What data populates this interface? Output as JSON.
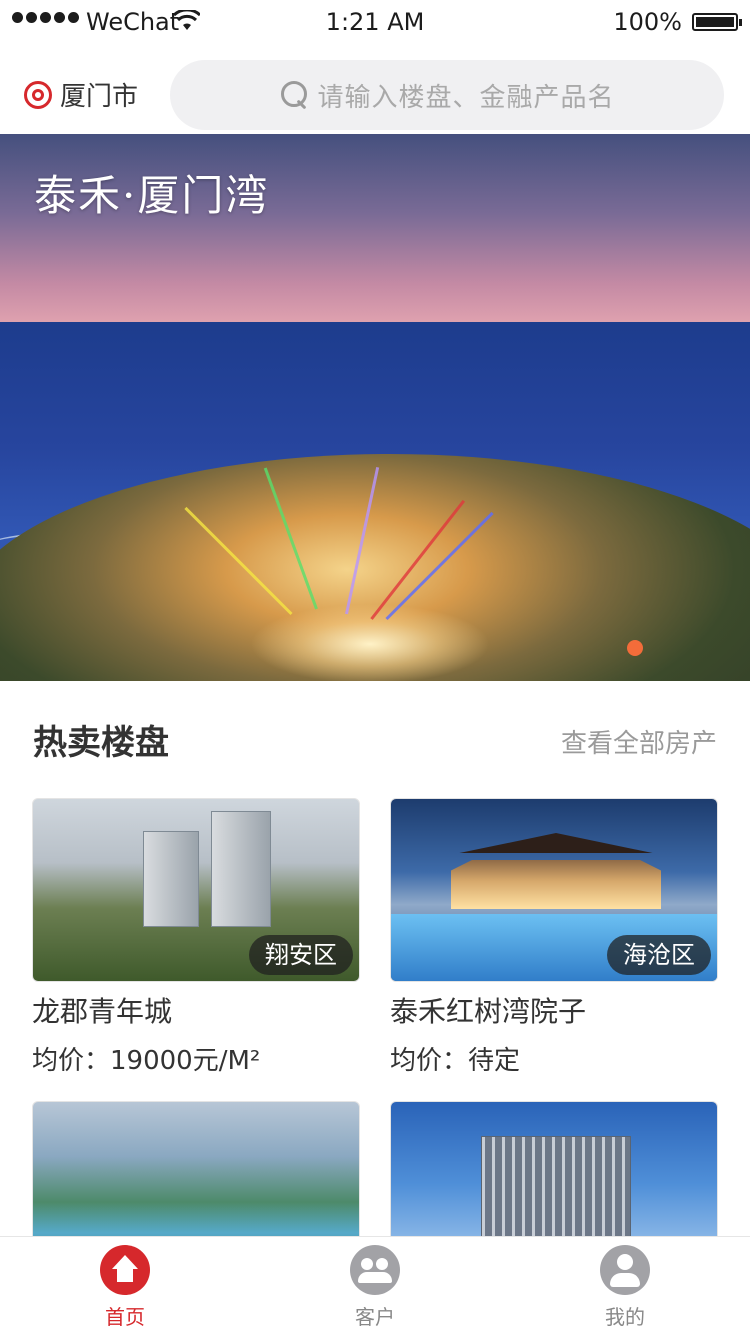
{
  "status_bar": {
    "carrier": "WeChat",
    "time": "1:21 AM",
    "battery": "100%"
  },
  "header": {
    "city": "厦门市",
    "search_placeholder": "请输入楼盘、金融产品名"
  },
  "banner": {
    "title": "泰禾·厦门湾"
  },
  "hot_section": {
    "title": "热卖楼盘",
    "view_all": "查看全部房产"
  },
  "listings": [
    {
      "district": "翔安区",
      "name": "龙郡青年城",
      "price": "均价：19000元/M²"
    },
    {
      "district": "海沧区",
      "name": "泰禾红树湾院子",
      "price": "均价：待定"
    },
    {
      "district": "",
      "name": "",
      "price": ""
    },
    {
      "district": "",
      "name": "",
      "price": ""
    }
  ],
  "tabbar": {
    "home": "首页",
    "clients": "客户",
    "me": "我的"
  },
  "colors": {
    "accent": "#d6282c",
    "indicator": "#f36c3a",
    "muted": "#9a9a9a"
  }
}
